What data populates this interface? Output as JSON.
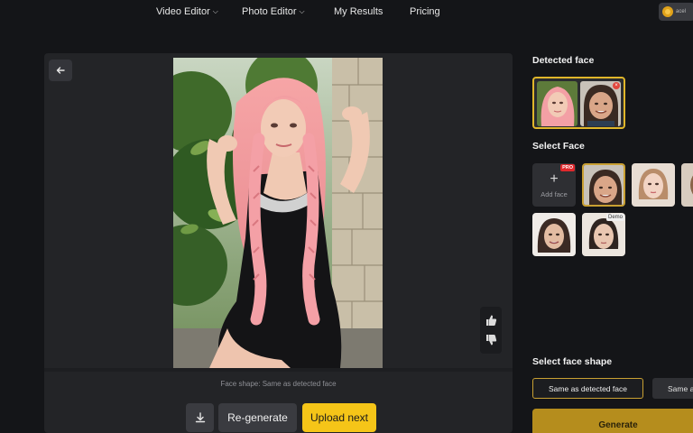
{
  "nav": {
    "items": [
      {
        "label": "Video Editor",
        "dropdown": true
      },
      {
        "label": "Photo Editor",
        "dropdown": true
      },
      {
        "label": "My Results",
        "dropdown": false
      },
      {
        "label": "Pricing",
        "dropdown": false
      }
    ],
    "account_text": "acel"
  },
  "main": {
    "face_shape_caption": "Face shape: Same as detected face",
    "actions": {
      "regenerate_label": "Re-generate",
      "upload_next_label": "Upload next"
    }
  },
  "sidebar": {
    "detected_face_heading": "Detected face",
    "select_face_heading": "Select Face",
    "add_face_label": "Add face",
    "pro_badge": "PRO",
    "demo_badge": "Demo",
    "select_shape_heading": "Select face shape",
    "shape_options": [
      "Same as detected face",
      "Same a"
    ],
    "generate_label": "Generate"
  },
  "colors": {
    "accent": "#f5c518",
    "generate": "#b58d1d",
    "background": "#141518",
    "panel": "#232427"
  }
}
